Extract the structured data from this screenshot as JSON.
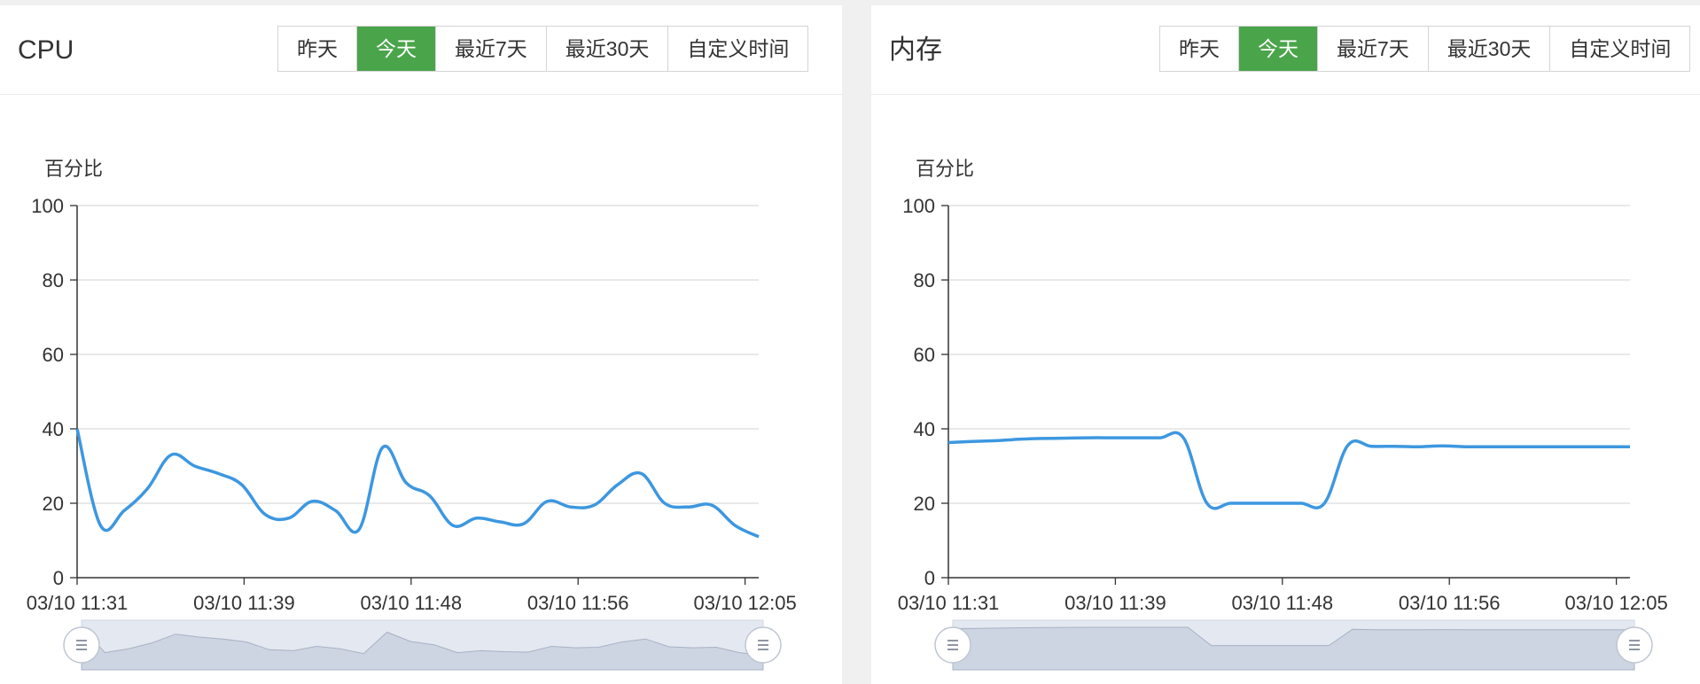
{
  "range_buttons": [
    "昨天",
    "今天",
    "最近7天",
    "最近30天",
    "自定义时间"
  ],
  "active_range": "今天",
  "colors": {
    "line": "#3d97e0",
    "active_button": "#4aa44a",
    "grid": "#dcdcdc",
    "slider_fill": "#cdd5e2"
  },
  "chart_data": [
    {
      "type": "line",
      "title": "CPU",
      "ylabel": "百分比",
      "ylim": [
        0,
        100
      ],
      "yticks": [
        "0",
        "20",
        "40",
        "60",
        "80",
        "100"
      ],
      "xtick_labels": [
        "03/10 11:31",
        "03/10 11:39",
        "03/10 11:48",
        "03/10 11:56",
        "03/10 12:05"
      ],
      "grid": true,
      "series": [
        {
          "values": [
            40,
            14,
            18,
            24,
            33,
            30,
            28,
            25,
            17,
            16,
            20.5,
            18,
            13,
            35,
            25.5,
            22,
            14,
            16,
            15,
            14.5,
            20.5,
            19,
            19.5,
            25,
            28,
            20,
            19,
            19.5,
            14,
            11
          ]
        }
      ]
    },
    {
      "type": "line",
      "title": "内存",
      "ylabel": "百分比",
      "ylim": [
        0,
        100
      ],
      "yticks": [
        "0",
        "20",
        "40",
        "60",
        "80",
        "100"
      ],
      "xtick_labels": [
        "03/10 11:31",
        "03/10 11:39",
        "03/10 11:48",
        "03/10 11:56",
        "03/10 12:05"
      ],
      "grid": true,
      "series": [
        {
          "values": [
            36.3,
            36.6,
            36.8,
            37.2,
            37.4,
            37.5,
            37.6,
            37.6,
            37.6,
            37.6,
            37.6,
            20,
            20,
            20,
            20,
            20,
            20,
            35.6,
            35.3,
            35.3,
            35.2,
            35.4,
            35.2,
            35.2,
            35.2,
            35.2,
            35.2,
            35.2,
            35.2,
            35.2
          ]
        }
      ]
    }
  ]
}
